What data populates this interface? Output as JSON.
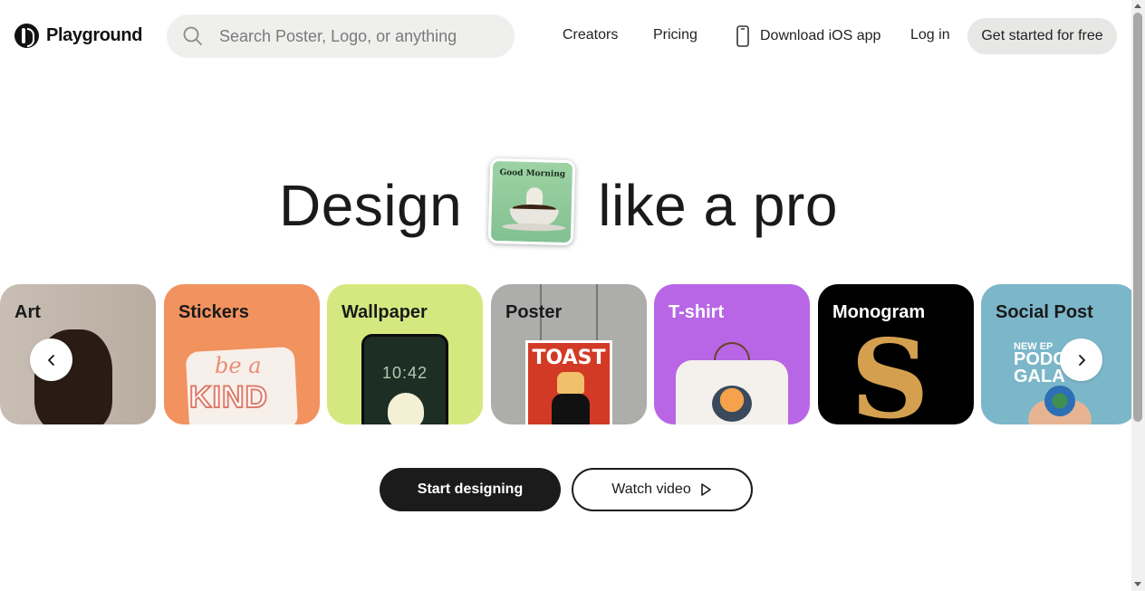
{
  "header": {
    "brand": "Playground",
    "search_placeholder": "Search Poster, Logo, or anything",
    "nav": {
      "creators": "Creators",
      "pricing": "Pricing",
      "ios": "Download iOS app",
      "login": "Log in"
    },
    "cta": "Get started for free"
  },
  "hero": {
    "before": "Design",
    "after": "like a pro",
    "card_title": "Good Morning"
  },
  "categories": [
    {
      "label": "Art"
    },
    {
      "label": "Stickers",
      "art_text": [
        "be a",
        "KIND"
      ]
    },
    {
      "label": "Wallpaper",
      "art_text": "10:42"
    },
    {
      "label": "Poster",
      "art_text": "TOAST"
    },
    {
      "label": "T-shirt"
    },
    {
      "label": "Monogram",
      "art_text": "S"
    },
    {
      "label": "Social Post",
      "art_text": [
        "NEW EP",
        "PODC",
        "GALA"
      ]
    }
  ],
  "buttons": {
    "start": "Start designing",
    "video": "Watch video"
  },
  "icons": {
    "search": "search-icon",
    "phone": "phone-icon",
    "prev": "chevron-left-icon",
    "next": "chevron-right-icon",
    "play": "play-icon"
  }
}
